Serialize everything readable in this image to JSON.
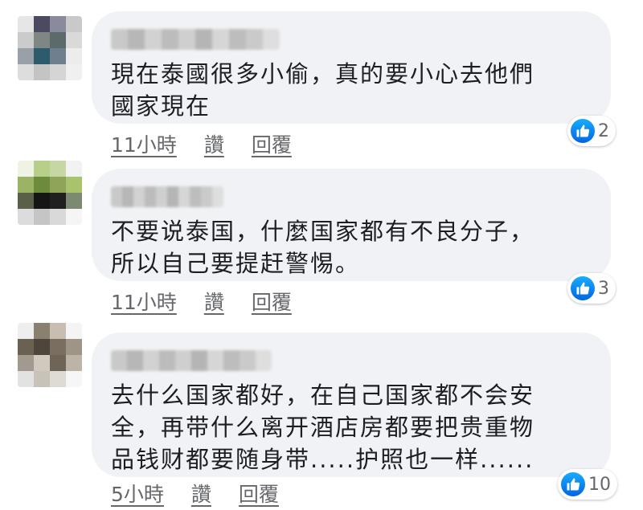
{
  "comments": [
    {
      "text": "現在泰國很多小偷，真的要小心去他們\n國家現在",
      "time": "11小時",
      "like_label": "讚",
      "reply_label": "回覆",
      "reaction_count": "2",
      "avatar_colors": [
        "#e6e6e6",
        "#4b4a60",
        "#8a8a9c",
        "#c9c9c9",
        "#cbcbcb",
        "#7e8783",
        "#5d6a6a",
        "#d9d9d9",
        "#9aa0a8",
        "#2e5a6e",
        "#6f7f8e",
        "#ececec",
        "#dddddd",
        "#c4c4c4",
        "#d5d5d5",
        "#f0f0f0"
      ]
    },
    {
      "text": "不要说泰国，什麼国家都有不良分子，\n所以自己要提赶警惕。",
      "time": "11小時",
      "like_label": "讚",
      "reply_label": "回覆",
      "reaction_count": "3",
      "avatar_colors": [
        "#eef3e4",
        "#b8cf8a",
        "#c6d7a4",
        "#f2f2f2",
        "#9bb364",
        "#6e8a3c",
        "#8fa458",
        "#a9c26c",
        "#5a5f4a",
        "#151515",
        "#202020",
        "#7b8a70",
        "#dcdcdc",
        "#c5c5c5",
        "#d9d9d9",
        "#f5f5f5"
      ]
    },
    {
      "text": "去什么国家都好，在自己国家都不会安\n全，再带什么离开酒店房都要把贵重物\n品钱财都要随身带.....护照也一样......",
      "time": "5小時",
      "like_label": "讚",
      "reply_label": "回覆",
      "reaction_count": "10",
      "avatar_colors": [
        "#eeeeee",
        "#8a8070",
        "#c7beb1",
        "#f4f4f4",
        "#6b6152",
        "#4e463c",
        "#7a6e60",
        "#9f9587",
        "#a29a8e",
        "#d0c9bf",
        "#6f6458",
        "#bdb4a8",
        "#e2e2e2",
        "#c9c2b8",
        "#dedad4",
        "#f6f6f6"
      ]
    }
  ]
}
